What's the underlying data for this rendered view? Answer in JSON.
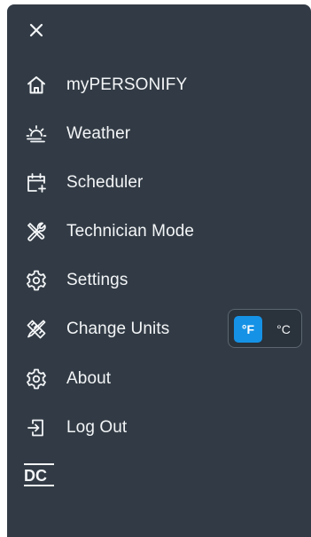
{
  "menu": {
    "items": [
      {
        "label": "myPERSONIFY",
        "icon": "home-icon"
      },
      {
        "label": "Weather",
        "icon": "weather-sun-icon"
      },
      {
        "label": "Scheduler",
        "icon": "calendar-add-icon"
      },
      {
        "label": "Technician Mode",
        "icon": "tools-icon"
      },
      {
        "label": "Settings",
        "icon": "gear-icon"
      },
      {
        "label": "Change Units",
        "icon": "change-units-icon"
      },
      {
        "label": "About",
        "icon": "gear-icon"
      },
      {
        "label": "Log Out",
        "icon": "logout-icon"
      }
    ]
  },
  "units": {
    "fahrenheit": "°F",
    "celsius": "°C",
    "selected": "°F"
  },
  "logo": {
    "text": "DC"
  },
  "colors": {
    "drawer_background": "#323b45",
    "text": "#f3f5f7",
    "accent": "#1592e6"
  }
}
